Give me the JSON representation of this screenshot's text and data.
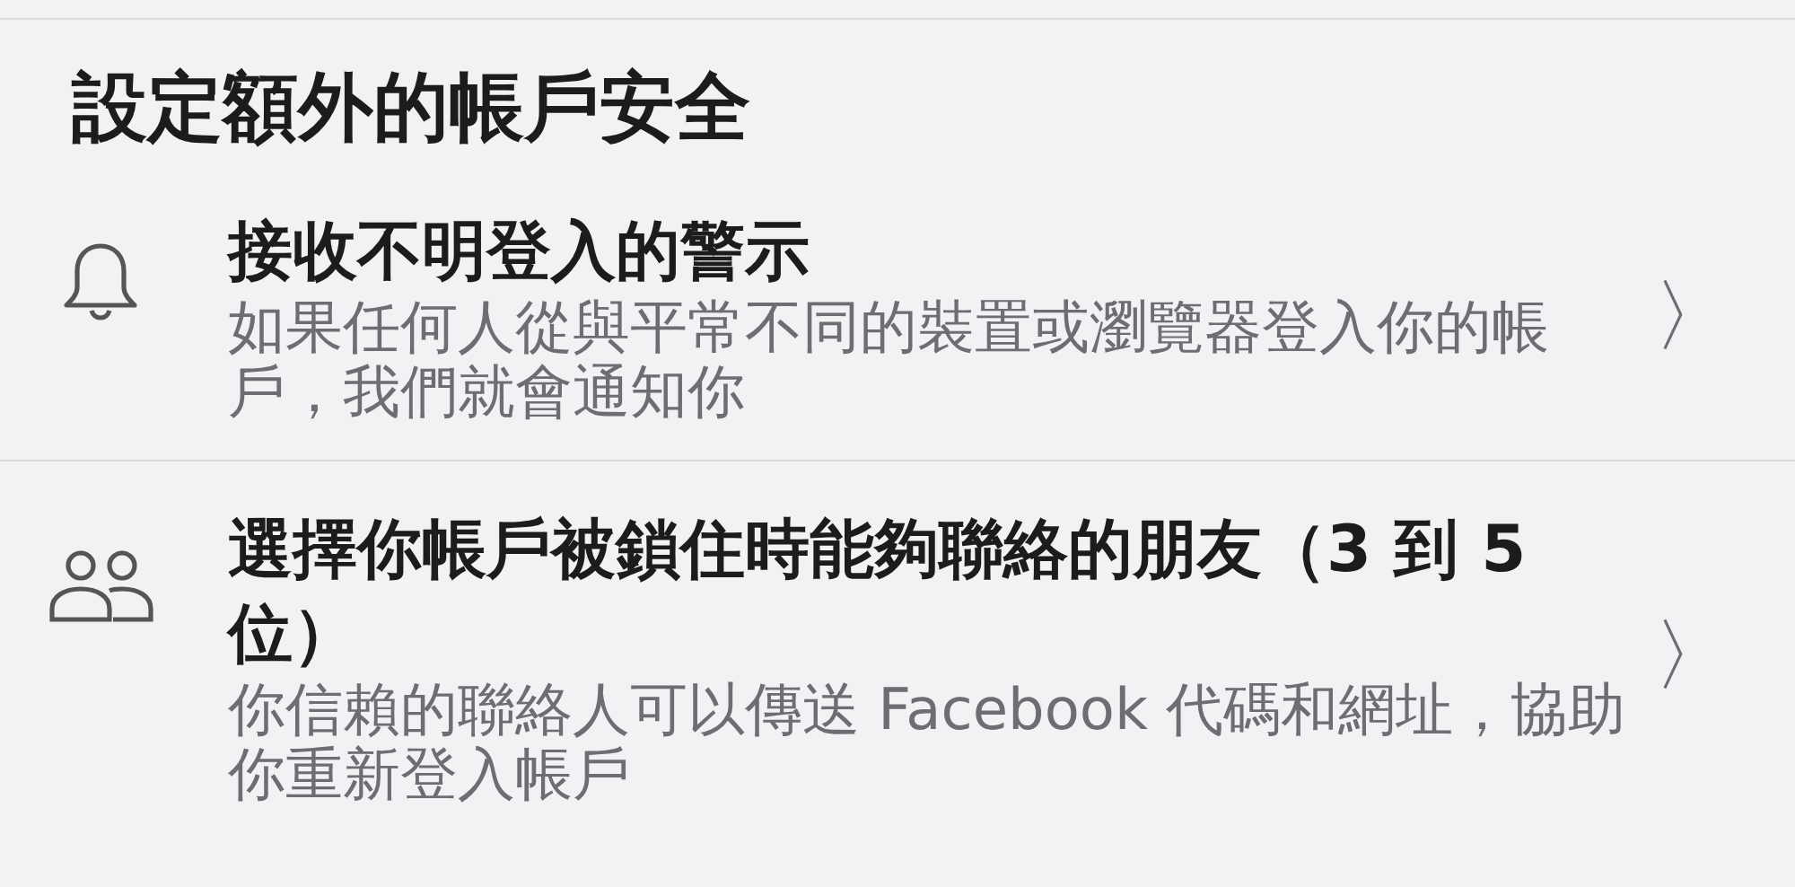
{
  "heading": "設定額外的帳戶安全",
  "items": [
    {
      "kind": "bell",
      "title": "接收不明登入的警示",
      "description": "如果任何人從與平常不同的裝置或瀏覽器登入你的帳戶，我們就會通知你",
      "chevron": "〉"
    },
    {
      "kind": "people",
      "title": "選擇你帳戶被鎖住時能夠聯絡的朋友（3 到 5 位）",
      "description": "你信賴的聯絡人可以傳送 Facebook 代碼和網址，協助你重新登入帳戶",
      "chevron": "〉"
    }
  ]
}
